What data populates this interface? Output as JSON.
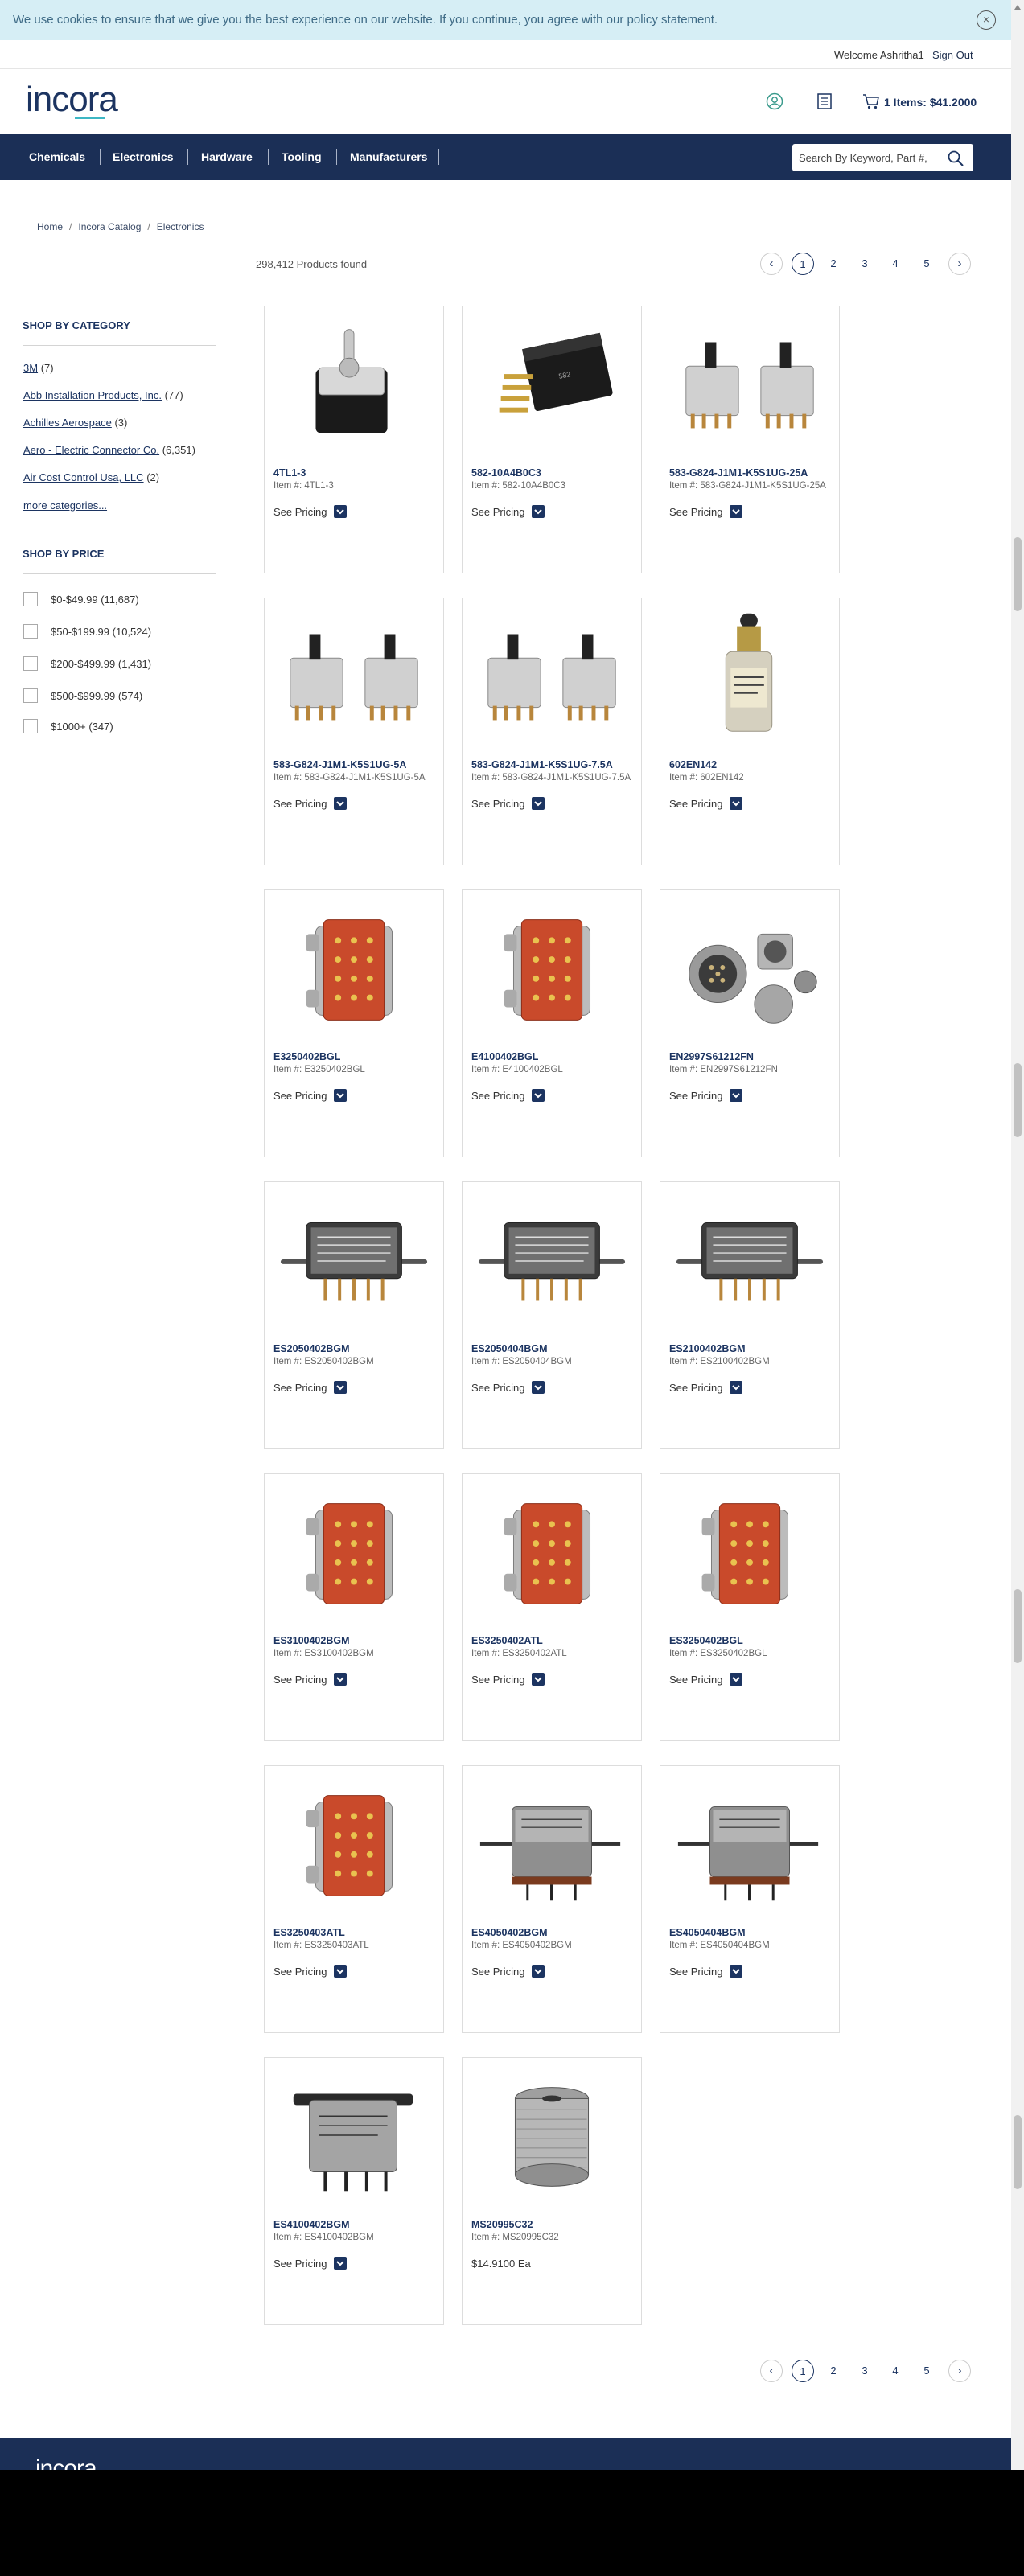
{
  "cookie_banner": {
    "text": "We use cookies to ensure that we give you the best experience on our website. If you continue, you agree with our policy statement.",
    "close_symbol": "×"
  },
  "topbar": {
    "welcome": "Welcome Ashritha1",
    "sign_out": "Sign Out"
  },
  "header": {
    "logo": "incora",
    "cart": "1 Items: $41.2000"
  },
  "nav": {
    "items": [
      "Chemicals",
      "Electronics",
      "Hardware",
      "Tooling",
      "Manufacturers"
    ],
    "search_placeholder": "Search By Keyword, Part #,"
  },
  "breadcrumb": [
    "Home",
    "Incora Catalog",
    "Electronics"
  ],
  "results": {
    "count": "298,412 Products found"
  },
  "pagination": {
    "prev": "‹",
    "next": "›",
    "pages": [
      "1",
      "2",
      "3",
      "4",
      "5"
    ]
  },
  "sidebar": {
    "category_heading": "SHOP BY CATEGORY",
    "categories": [
      {
        "name": "3M",
        "count": "(7)"
      },
      {
        "name": "Abb Installation Products, Inc.",
        "count": "(77)"
      },
      {
        "name": "Achilles Aerospace",
        "count": "(3)"
      },
      {
        "name": "Aero - Electric Connector Co.",
        "count": "(6,351)"
      },
      {
        "name": "Air Cost Control Usa, LLC",
        "count": "(2)"
      }
    ],
    "more": "more categories...",
    "price_heading": "SHOP BY PRICE",
    "prices": [
      {
        "range": "$0-$49.99",
        "count": "(11,687)"
      },
      {
        "range": "$50-$199.99",
        "count": "(10,524)"
      },
      {
        "range": "$200-$499.99",
        "count": "(1,431)"
      },
      {
        "range": "$500-$999.99",
        "count": "(574)"
      },
      {
        "range": "$1000+",
        "count": "(347)"
      }
    ]
  },
  "see_pricing": "See Pricing",
  "products": [
    {
      "name": "4TL1-3",
      "item": "Item #: 4TL1-3",
      "image": "toggle-switch"
    },
    {
      "name": "582-10A4B0C3",
      "item": "Item #: 582-10A4B0C3",
      "image": "relay-block"
    },
    {
      "name": "583-G824-J1M1-K5S1UG-25A",
      "item": "Item #: 583-G824-J1M1-K5S1UG-25A",
      "image": "breaker-pair"
    },
    {
      "name": "583-G824-J1M1-K5S1UG-5A",
      "item": "Item #: 583-G824-J1M1-K5S1UG-5A",
      "image": "breaker-pair"
    },
    {
      "name": "583-G824-J1M1-K5S1UG-7.5A",
      "item": "Item #: 583-G824-J1M1-K5S1UG-7.5A",
      "image": "breaker-pair"
    },
    {
      "name": "602EN142",
      "item": "Item #: 602EN142",
      "image": "push-switch"
    },
    {
      "name": "E3250402BGL",
      "item": "Item #: E3250402BGL",
      "image": "red-relay"
    },
    {
      "name": "E4100402BGL",
      "item": "Item #: E4100402BGL",
      "image": "red-relay"
    },
    {
      "name": "EN2997S61212FN",
      "item": "Item #: EN2997S61212FN",
      "image": "circular-connector"
    },
    {
      "name": "ES2050402BGM",
      "item": "Item #: ES2050402BGM",
      "image": "metal-relay"
    },
    {
      "name": "ES2050404BGM",
      "item": "Item #: ES2050404BGM",
      "image": "metal-relay"
    },
    {
      "name": "ES2100402BGM",
      "item": "Item #: ES2100402BGM",
      "image": "metal-relay"
    },
    {
      "name": "ES3100402BGM",
      "item": "Item #: ES3100402BGM",
      "image": "red-relay"
    },
    {
      "name": "ES3250402ATL",
      "item": "Item #: ES3250402ATL",
      "image": "red-relay"
    },
    {
      "name": "ES3250402BGL",
      "item": "Item #: ES3250402BGL",
      "image": "red-relay"
    },
    {
      "name": "ES3250403ATL",
      "item": "Item #: ES3250403ATL",
      "image": "red-relay"
    },
    {
      "name": "ES4050402BGM",
      "item": "Item #: ES4050402BGM",
      "image": "sealed-relay"
    },
    {
      "name": "ES4050404BGM",
      "item": "Item #: ES4050404BGM",
      "image": "sealed-relay"
    },
    {
      "name": "ES4100402BGM",
      "item": "Item #: ES4100402BGM",
      "image": "bracket-relay"
    },
    {
      "name": "MS20995C32",
      "item": "Item #: MS20995C32",
      "image": "wire-spool",
      "price": "$14.9100 Ea"
    }
  ],
  "footer": {
    "logo": "incora"
  },
  "colors": {
    "navy": "#1b2f56",
    "accent": "#3db7c4",
    "cookie_bg": "#d6eef5"
  }
}
